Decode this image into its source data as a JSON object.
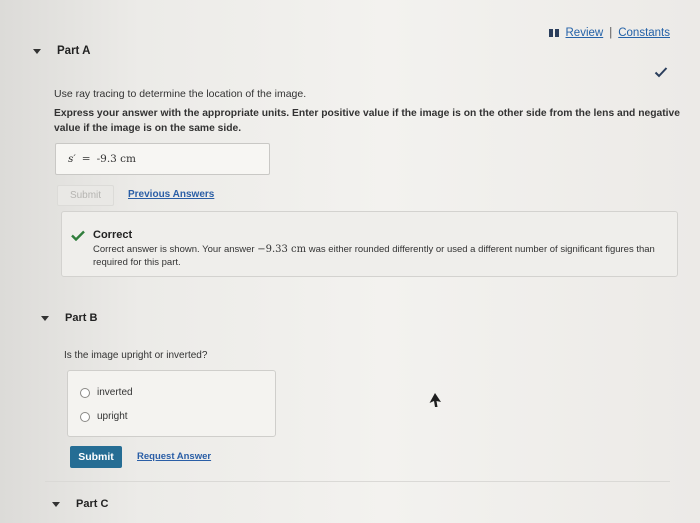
{
  "top_links": {
    "review": "Review",
    "separator": "|",
    "constants": "Constants"
  },
  "part_a": {
    "label": "Part A",
    "question": "Use ray tracing to determine the location of the image.",
    "instructions": "Express your answer with the appropriate units. Enter positive value if the image is on the other side from the lens and negative value if the image is on the same side.",
    "answer_var": "s′",
    "answer_eq": "=",
    "answer_value": "-9.3 cm",
    "submit_label": "Submit",
    "previous_answers_label": "Previous Answers",
    "feedback": {
      "title": "Correct",
      "msg_pre": "Correct answer is shown. Your answer ",
      "msg_math": "−9.33 cm",
      "msg_post": " was either rounded differently or used a different number of significant figures than required for this part."
    }
  },
  "part_b": {
    "label": "Part B",
    "question": "Is the image upright or inverted?",
    "options": [
      "inverted",
      "upright"
    ],
    "submit_label": "Submit",
    "request_answer_label": "Request Answer"
  },
  "part_c": {
    "label": "Part C"
  },
  "colors": {
    "link": "#2462a8",
    "submit_bg": "#256d94",
    "check": "#2f7d3b"
  }
}
